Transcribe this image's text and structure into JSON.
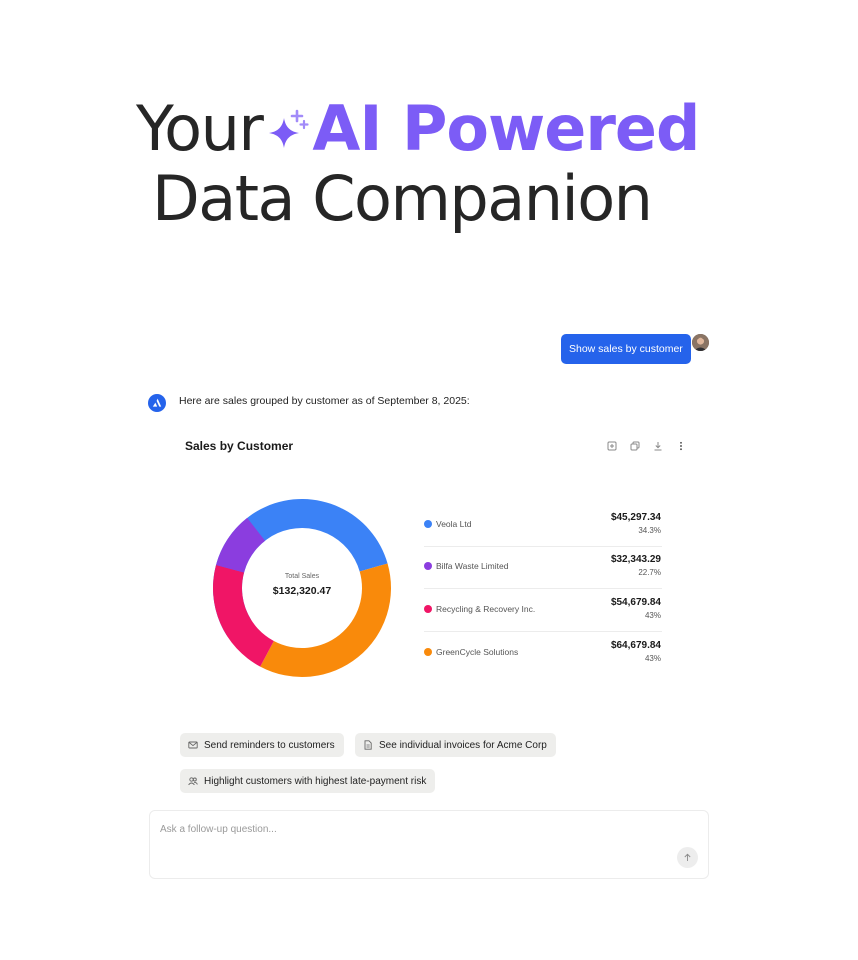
{
  "hero": {
    "line1_prefix": "Your",
    "line1_highlight": "AI Powered",
    "line2": "Data Companion",
    "accent_color": "#7c5cf6",
    "sparkle_icon": "sparkle-icon"
  },
  "chat": {
    "user_message": "Show sales by customer",
    "assistant_intro": "Here are sales grouped by customer as of September 8, 2025:",
    "user_bubble_color": "#2563eb"
  },
  "card": {
    "title": "Sales by Customer",
    "tools": [
      "expand-icon",
      "copy-icon",
      "download-icon",
      "more-icon"
    ],
    "center_label": "Total Sales",
    "center_value": "$132,320.47"
  },
  "chart_data": {
    "type": "pie",
    "title": "Sales by Customer",
    "categories": [
      "Veola Ltd",
      "Bilfa Waste Limited",
      "Recycling & Recovery Inc.",
      "GreenCycle Solutions"
    ],
    "values": [
      45297.34,
      32343.29,
      54679.84,
      64679.84
    ],
    "amount_labels": [
      "$45,297.34",
      "$32,343.29",
      "$54,679.84",
      "$64,679.84"
    ],
    "percent_labels": [
      "34.3%",
      "22.7%",
      "43%",
      "43%"
    ],
    "colors": [
      "#3b82f6",
      "#8b3ddf",
      "#f01566",
      "#f98a0b"
    ],
    "legend_position": "right"
  },
  "suggestions": [
    {
      "label": "Send reminders to customers",
      "icon": "mail-icon"
    },
    {
      "label": "See individual invoices for Acme Corp",
      "icon": "document-icon"
    },
    {
      "label": "Highlight customers with highest late-payment risk",
      "icon": "users-icon"
    }
  ],
  "input": {
    "placeholder": "Ask a follow-up question...",
    "value": ""
  }
}
